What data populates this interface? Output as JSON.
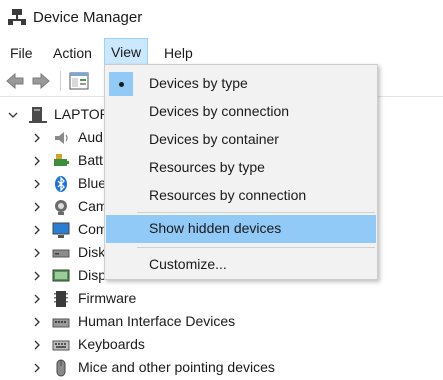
{
  "window": {
    "title": "Device Manager"
  },
  "menubar": {
    "items": [
      "File",
      "Action",
      "View",
      "Help"
    ]
  },
  "view_menu": {
    "items": [
      {
        "label": "Devices by type",
        "checked": true
      },
      {
        "label": "Devices by connection"
      },
      {
        "label": "Devices by container"
      },
      {
        "label": "Resources by type"
      },
      {
        "label": "Resources by connection"
      },
      {
        "label": "Show hidden devices",
        "highlighted": true
      },
      {
        "label": "Customize..."
      }
    ]
  },
  "tree": {
    "root": "LAPTOP-",
    "nodes": [
      {
        "label": "Aud",
        "icon": "speaker-icon"
      },
      {
        "label": "Batt",
        "icon": "battery-icon"
      },
      {
        "label": "Blue",
        "icon": "bluetooth-icon"
      },
      {
        "label": "Cam",
        "icon": "camera-icon"
      },
      {
        "label": "Com",
        "icon": "computer-icon"
      },
      {
        "label": "Disk",
        "icon": "disk-drive-icon"
      },
      {
        "label": "Disp",
        "icon": "display-adapter-icon"
      },
      {
        "label": "Firmware",
        "icon": "firmware-icon"
      },
      {
        "label": "Human Interface Devices",
        "icon": "hid-icon"
      },
      {
        "label": "Keyboards",
        "icon": "keyboard-icon"
      },
      {
        "label": "Mice and other pointing devices",
        "icon": "mouse-icon"
      }
    ]
  },
  "colors": {
    "menu_open_bg": "#cce8ff",
    "menu_highlight": "#91c9f7",
    "bluetooth": "#1e73d6"
  }
}
